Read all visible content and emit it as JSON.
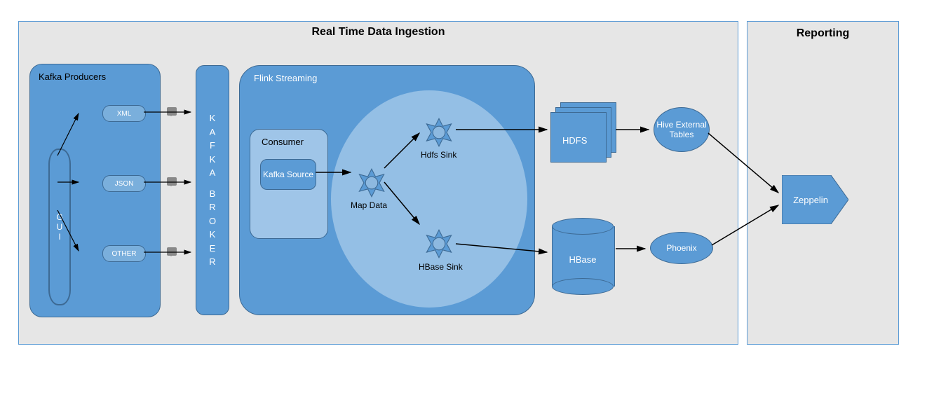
{
  "main": {
    "title": "Real Time Data Ingestion",
    "producers": {
      "title": "Kafka Producers",
      "gui": "G\nU\nI",
      "items": [
        "XML",
        "JSON",
        "OTHER"
      ]
    },
    "broker": "KAFKA BROKER",
    "flink": {
      "title": "Flink Streaming",
      "consumer_title": "Consumer",
      "kafka_source": "Kafka Source",
      "map": "Map Data",
      "hdfs_sink": "Hdfs Sink",
      "hbase_sink": "HBase Sink"
    },
    "hdfs": "HDFS",
    "hbase": "HBase",
    "hive": "Hive External Tables",
    "phoenix": "Phoenix"
  },
  "reporting": {
    "title": "Reporting",
    "zeppelin": "Zeppelin"
  }
}
